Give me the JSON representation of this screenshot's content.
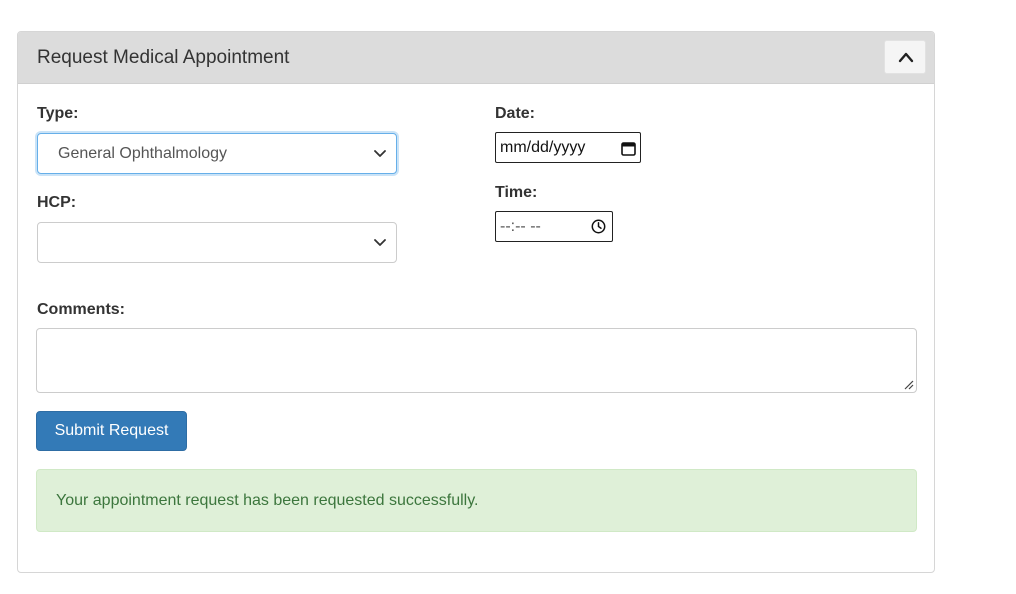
{
  "panel": {
    "title": "Request Medical Appointment",
    "collapse_icon": "chevron-up-icon"
  },
  "form": {
    "type": {
      "label": "Type:",
      "value": "General Ophthalmology",
      "icon": "chevron-down-icon"
    },
    "hcp": {
      "label": "HCP:",
      "value": "",
      "icon": "chevron-down-icon"
    },
    "date": {
      "label": "Date:",
      "placeholder": "mm/dd/yyyy",
      "icon": "calendar-icon"
    },
    "time": {
      "label": "Time:",
      "placeholder": "--:-- --",
      "icon": "clock-icon"
    },
    "comments": {
      "label": "Comments:",
      "value": "",
      "icon": "resize-handle-icon"
    },
    "submit_label": "Submit Request"
  },
  "alert": {
    "message": "Your appointment request has been requested successfully."
  },
  "colors": {
    "primary": "#337ab7",
    "success_bg": "#dff0d8",
    "success_text": "#3c763d",
    "heading_bg": "#dcdcdc",
    "focus_border": "#66afe9"
  }
}
